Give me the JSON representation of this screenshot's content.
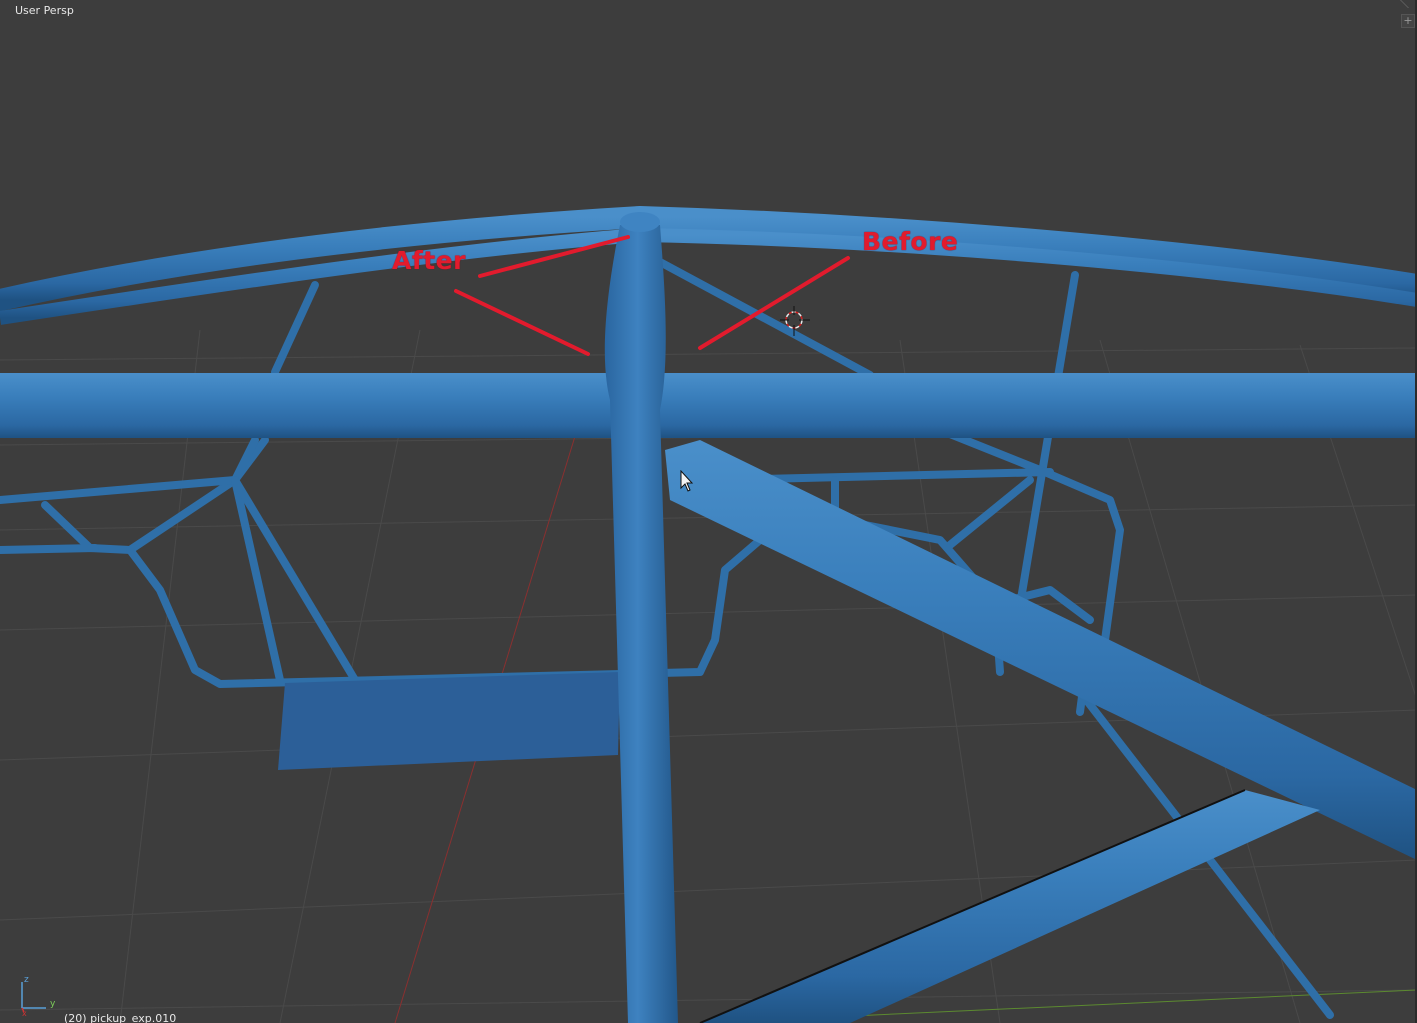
{
  "viewport": {
    "view_name": "User Persp",
    "object_info": "(20) pickup_exp.010",
    "split_widget_icon": "+",
    "background_color": "#3d3d3d",
    "mesh_color": "#2f6fa8"
  },
  "annotations": {
    "after_label": "After",
    "before_label": "Before",
    "color": "#e21b2d"
  },
  "gizmo": {
    "x_axis": "x",
    "y_axis": "y",
    "z_axis": "z"
  },
  "icons": {
    "cursor": "mouse-pointer-icon",
    "crosshair": "3d-cursor-icon",
    "axes": "axes-gizmo-icon",
    "split": "area-split-icon"
  }
}
